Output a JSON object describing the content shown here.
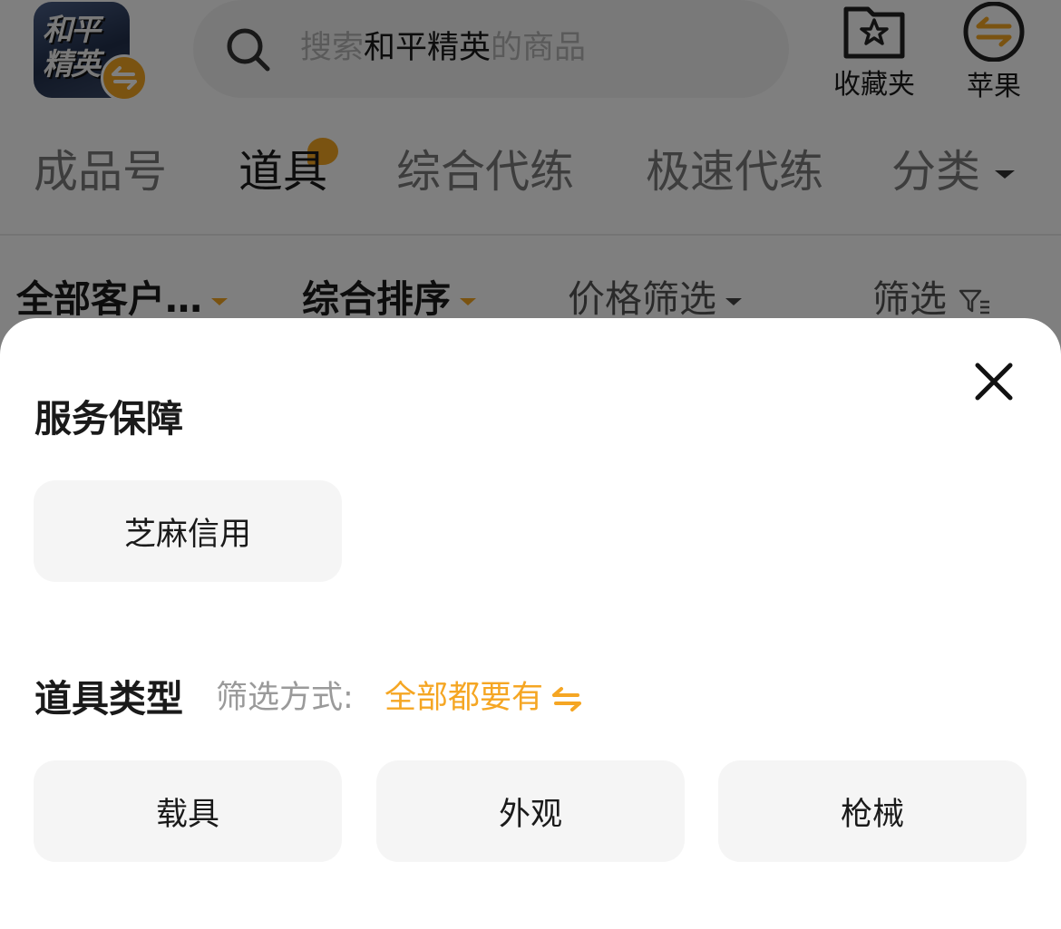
{
  "header": {
    "game_icon_text": "和平精英",
    "search": {
      "prefix": "搜索",
      "keyword": "和平精英",
      "suffix": "的商品"
    },
    "favorites_label": "收藏夹",
    "platform_label": "苹果"
  },
  "tabs": [
    {
      "label": "成品号",
      "active": false
    },
    {
      "label": "道具",
      "active": true
    },
    {
      "label": "综合代练",
      "active": false
    },
    {
      "label": "极速代练",
      "active": false
    }
  ],
  "category_label": "分类",
  "filters": {
    "client": "全部客户…",
    "sort": "综合排序",
    "price": "价格筛选",
    "filter": "筛选"
  },
  "sheet": {
    "service_title": "服务保障",
    "service_options": [
      "芝麻信用"
    ],
    "type_title": "道具类型",
    "mode_label": "筛选方式:",
    "mode_value": "全部都要有",
    "type_options": [
      "载具",
      "外观",
      "枪械"
    ]
  },
  "colors": {
    "accent": "#f5a623",
    "chip_bg": "#f5f5f5",
    "overlay": "rgba(0,0,0,0.5)"
  },
  "icons": {
    "search": "search-icon",
    "favorites": "star-folder-icon",
    "platform_switch": "switch-arrows-icon",
    "filter": "filter-icon",
    "close": "close-icon"
  }
}
